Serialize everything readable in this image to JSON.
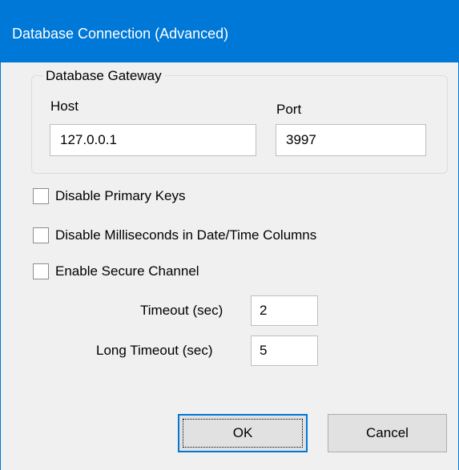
{
  "window": {
    "title": "Database Connection (Advanced)"
  },
  "gateway": {
    "legend": "Database Gateway",
    "host_label": "Host",
    "host_value": "127.0.0.1",
    "port_label": "Port",
    "port_value": "3997"
  },
  "options": {
    "disable_primary_keys": {
      "label": "Disable Primary Keys",
      "checked": false
    },
    "disable_milliseconds": {
      "label": "Disable Milliseconds in Date/Time Columns",
      "checked": false
    },
    "enable_secure_channel": {
      "label": "Enable Secure Channel",
      "checked": false
    }
  },
  "timeouts": {
    "timeout_label": "Timeout (sec)",
    "timeout_value": "2",
    "long_timeout_label": "Long Timeout (sec)",
    "long_timeout_value": "5"
  },
  "buttons": {
    "ok_label": "OK",
    "cancel_label": "Cancel"
  },
  "colors": {
    "titlebar": "#0078d7",
    "dialog_background": "#f0f0f0",
    "default_button_border": "#0078d7"
  }
}
